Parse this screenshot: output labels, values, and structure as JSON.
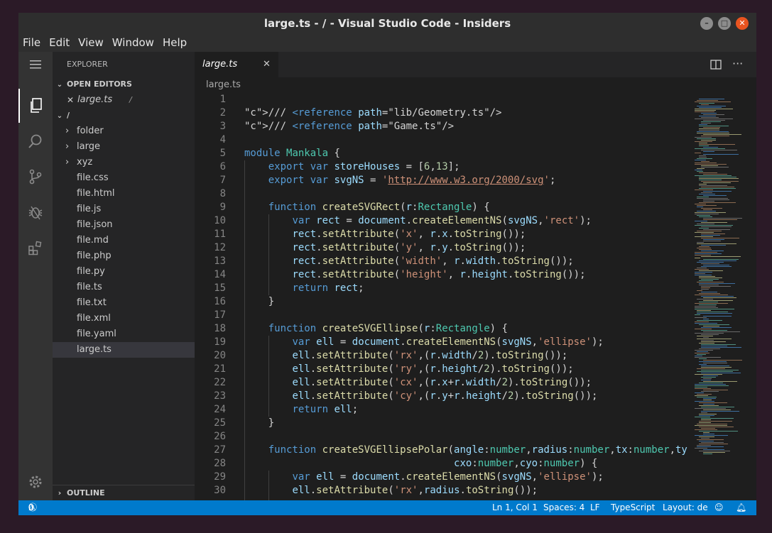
{
  "window": {
    "title": "large.ts - / - Visual Studio Code - Insiders"
  },
  "menu": [
    "File",
    "Edit",
    "View",
    "Window",
    "Help"
  ],
  "sidebar": {
    "title": "EXPLORER",
    "open_editors_label": "OPEN EDITORS",
    "open_editor": {
      "name": "large.ts",
      "path": "/"
    },
    "root_label": "/",
    "folders": [
      "folder",
      "large",
      "xyz"
    ],
    "files": [
      "file.css",
      "file.html",
      "file.js",
      "file.json",
      "file.md",
      "file.php",
      "file.py",
      "file.ts",
      "file.txt",
      "file.xml",
      "file.yaml",
      "large.ts"
    ],
    "outline_label": "OUTLINE"
  },
  "editor": {
    "tab_label": "large.ts",
    "breadcrumb": "large.ts",
    "line_numbers": [
      "1",
      "2",
      "3",
      "4",
      "5",
      "6",
      "7",
      "8",
      "9",
      "10",
      "11",
      "12",
      "13",
      "14",
      "15",
      "16",
      "17",
      "18",
      "19",
      "20",
      "21",
      "22",
      "23",
      "24",
      "25",
      "26",
      "27",
      "28",
      "29",
      "30"
    ],
    "lines": [
      "",
      "/// <reference path=\"lib/Geometry.ts\"/>",
      "/// <reference path=\"Game.ts\"/>",
      "",
      "module Mankala {",
      "    export var storeHouses = [6,13];",
      "    export var svgNS = 'http://www.w3.org/2000/svg';",
      "",
      "    function createSVGRect(r:Rectangle) {",
      "        var rect = document.createElementNS(svgNS,'rect');",
      "        rect.setAttribute('x', r.x.toString());",
      "        rect.setAttribute('y', r.y.toString());",
      "        rect.setAttribute('width', r.width.toString());",
      "        rect.setAttribute('height', r.height.toString());",
      "        return rect;",
      "    }",
      "",
      "    function createSVGEllipse(r:Rectangle) {",
      "        var ell = document.createElementNS(svgNS,'ellipse');",
      "        ell.setAttribute('rx',(r.width/2).toString());",
      "        ell.setAttribute('ry',(r.height/2).toString());",
      "        ell.setAttribute('cx',(r.x+r.width/2).toString());",
      "        ell.setAttribute('cy',(r.y+r.height/2).toString());",
      "        return ell;",
      "    }",
      "",
      "    function createSVGEllipsePolar(angle:number,radius:number,tx:number,ty",
      "                                   cxo:number,cyo:number) {",
      "        var ell = document.createElementNS(svgNS,'ellipse');",
      "        ell.setAttribute('rx',radius.toString());"
    ]
  },
  "status": {
    "errors": "0",
    "warnings": "0",
    "position": "Ln 1, Col 1",
    "spaces": "Spaces: 4",
    "eol": "LF",
    "language": "TypeScript",
    "layout": "Layout: de"
  },
  "colors": {
    "accent": "#007acc",
    "titlebar": "#2e2e2e",
    "sidebar": "#252526",
    "editor": "#1e1e1e",
    "close_button": "#e95420"
  }
}
